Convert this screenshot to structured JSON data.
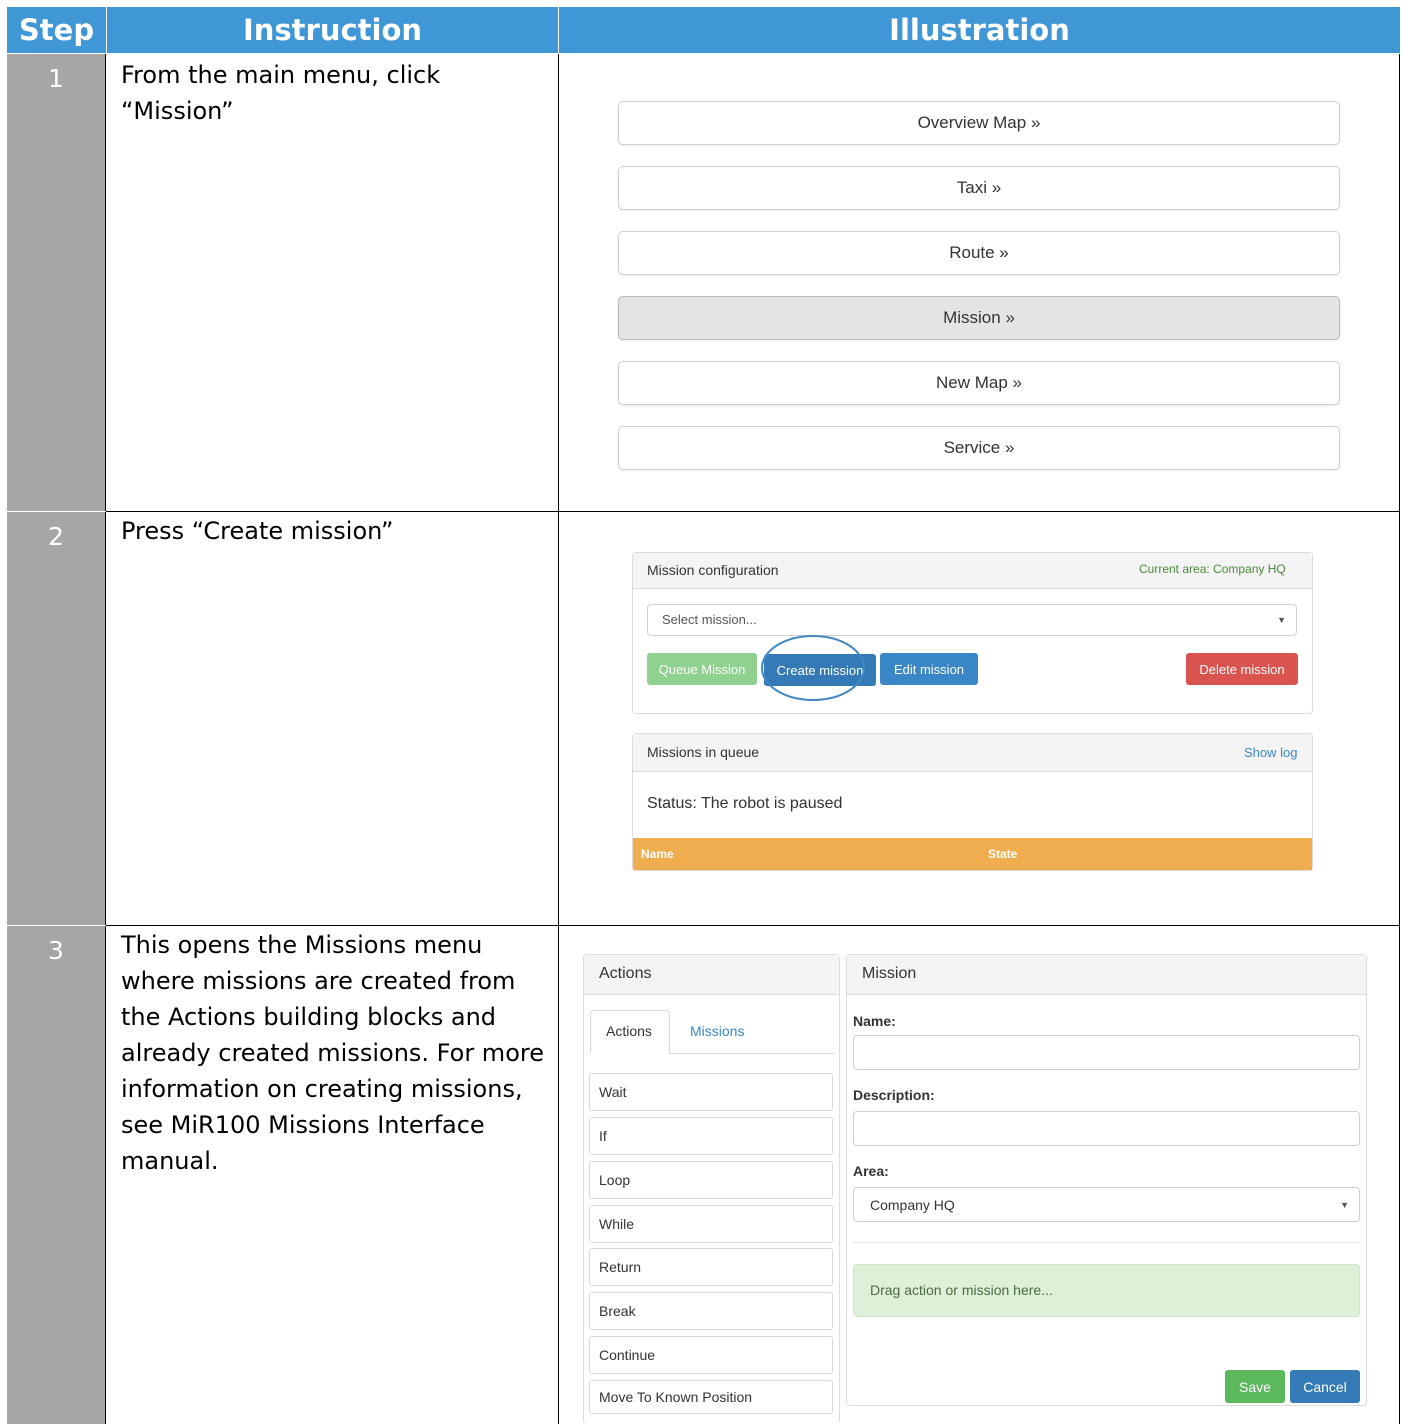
{
  "table": {
    "headers": {
      "step": "Step",
      "instruction": "Instruction",
      "illustration": "Illustration"
    },
    "rows": [
      {
        "step": "1",
        "instruction": "From the main menu, click “Mission”"
      },
      {
        "step": "2",
        "instruction": "Press “Create mission”"
      },
      {
        "step": "3",
        "instruction": "This opens the Missions menu where missions are created from the Actions building blocks and already created missions. For more information on creating missions, see MiR100 Missions Interface manual."
      }
    ]
  },
  "main_menu": {
    "items": [
      "Overview Map »",
      "Taxi »",
      "Route »",
      "Mission »",
      "New Map »",
      "Service »"
    ],
    "active": "Mission »"
  },
  "mission_config": {
    "title": "Mission configuration",
    "current_area": "Current area: Company HQ",
    "select_placeholder": "Select mission...",
    "buttons": {
      "queue": "Queue Mission",
      "create": "Create mission",
      "edit": "Edit mission",
      "delete": "Delete mission"
    },
    "colors": {
      "queue": "#8fd18f",
      "create": "#337ab7",
      "edit": "#3a87c8",
      "delete": "#d9534f",
      "highlight": "#3f88c5"
    }
  },
  "queue_panel": {
    "title": "Missions in queue",
    "show_log": "Show log",
    "status": "Status: The robot is paused",
    "columns": [
      "Name",
      "State"
    ],
    "header_color": "#f0ad4e"
  },
  "actions_panel": {
    "title": "Actions",
    "tabs": [
      "Actions",
      "Missions"
    ],
    "active_tab": "Actions",
    "items": [
      "Wait",
      "If",
      "Loop",
      "While",
      "Return",
      "Break",
      "Continue",
      "Move To Known Position"
    ]
  },
  "mission_panel": {
    "title": "Mission",
    "name_label": "Name:",
    "description_label": "Description:",
    "area_label": "Area:",
    "area_value": "Company HQ",
    "dropzone": "Drag action or mission here...",
    "save": "Save",
    "cancel": "Cancel",
    "colors": {
      "save": "#5cb85c",
      "cancel": "#337ab7",
      "dropzone": "#dff0d8"
    }
  }
}
